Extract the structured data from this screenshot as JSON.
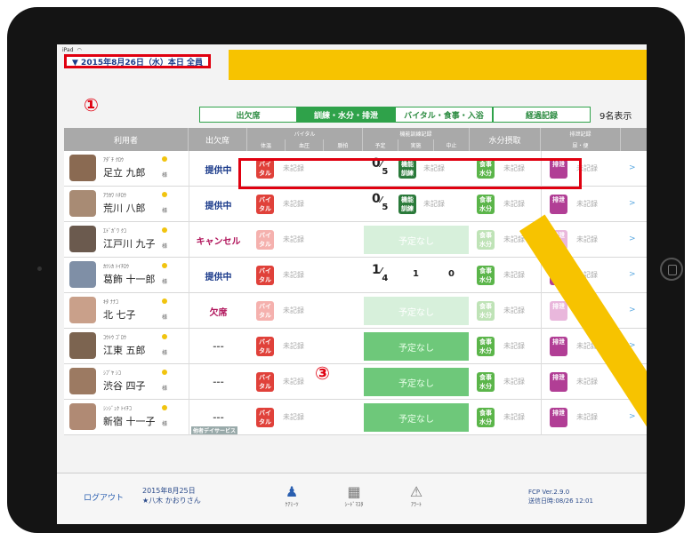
{
  "statusbar": {
    "device": "iPad",
    "wifi": "wifi-icon"
  },
  "header": {
    "date_label": "▼ 2015年8月26日（水）本日 全員",
    "marker1": "①",
    "count": "9名表示"
  },
  "tabs": [
    "出欠席",
    "訓練・水分・排泄",
    "バイタル・食事・入浴",
    "経過記録"
  ],
  "active_tab": 1,
  "columns": {
    "user": "利用者",
    "attendance": "出欠席",
    "vital": "バイタル",
    "vital_sub": [
      "体温",
      "血圧",
      "脈拍"
    ],
    "training": "機能訓練記録",
    "training_sub": [
      "予定",
      "実施",
      "中止"
    ],
    "water": "水分摂取",
    "excretion": "排泄記録",
    "excretion_sub": "尿・便"
  },
  "badges": {
    "vital": "バイ\nタル",
    "training": "機能\n訓練",
    "water": "食事\n水分",
    "excretion": "排泄"
  },
  "unrecorded": "未記録",
  "plan_none": "予定なし",
  "marker3": "③",
  "rows": [
    {
      "kana": "ｱﾀﾞﾁ ｸﾛｳ",
      "name": "足立 九郎",
      "sama": "様",
      "status": "提供中",
      "status_kind": "provide",
      "training": "0/5",
      "avatar": "#8a6a52"
    },
    {
      "kana": "ｱﾗｶﾜ ﾊﾁﾛｳ",
      "name": "荒川 八郎",
      "sama": "様",
      "status": "提供中",
      "status_kind": "provide",
      "training": "0/5",
      "avatar": "#a88b74"
    },
    {
      "kana": "ｴﾄﾞｶﾞﾜ ｸｺ",
      "name": "江戸川 九子",
      "sama": "様",
      "status": "キャンセル",
      "status_kind": "cancel",
      "training": "予定なし",
      "avatar": "#6b5a4e"
    },
    {
      "kana": "ｶﾂｼｶ ﾄｲﾁﾛｳ",
      "name": "葛飾 十一郎",
      "sama": "様",
      "status": "提供中",
      "status_kind": "provide",
      "training": "1/4",
      "done": "1",
      "stop": "0",
      "avatar": "#7f8fa6"
    },
    {
      "kana": "ｷﾀ ﾅﾅｺ",
      "name": "北 七子",
      "sama": "様",
      "status": "欠席",
      "status_kind": "absent",
      "training": "予定なし",
      "avatar": "#c9a08a"
    },
    {
      "kana": "ｺｳﾄｳ ｺﾞﾛｳ",
      "name": "江東 五郎",
      "sama": "様",
      "status": "---",
      "status_kind": "none",
      "training": "予定なし",
      "avatar": "#7c6450"
    },
    {
      "kana": "ｼﾌﾞﾔ ｼｺ",
      "name": "渋谷 四子",
      "sama": "様",
      "status": "---",
      "status_kind": "none",
      "training": "予定なし",
      "avatar": "#9c7a62"
    },
    {
      "kana": "ｼﾝｼﾞｭｸ ﾄｲﾁｺ",
      "name": "新宿 十一子",
      "sama": "様",
      "status": "---",
      "status_kind": "none",
      "status_sub": "他者デイサービス",
      "training": "予定なし",
      "avatar": "#b08a74"
    }
  ],
  "footer": {
    "logout": "ログアウト",
    "date": "2015年8月25日",
    "staff": "★八木 かおりさん",
    "icon1": "ｹｱﾐｰﾂ",
    "icon2": "ｼｰﾄﾞﾏｽﾀ",
    "icon3": "ｱﾗｰﾄ",
    "version": "FCP Ver.2.9.0",
    "sent": "送信日時:08/26 12:01"
  }
}
